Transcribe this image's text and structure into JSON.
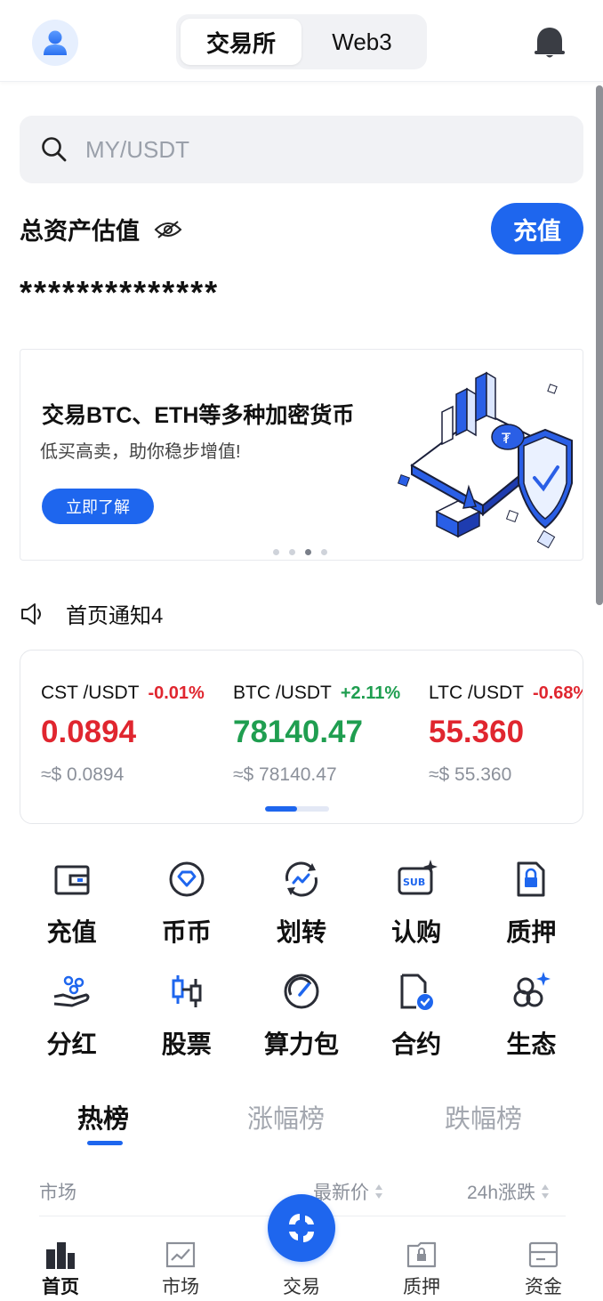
{
  "header": {
    "tabs": [
      {
        "label": "交易所",
        "active": true
      },
      {
        "label": "Web3",
        "active": false
      }
    ],
    "icons": {
      "avatar": "user-icon",
      "bell": "bell-icon"
    }
  },
  "search": {
    "placeholder": "MY/USDT",
    "icon": "search-icon"
  },
  "assets": {
    "label": "总资产估值",
    "value": "**************",
    "recharge_label": "充值",
    "eye_icon": "eye-hidden-icon"
  },
  "banner": {
    "title": "交易BTC、ETH等多种加密货币",
    "subtitle": "低买高卖，助你稳步增值!",
    "button_label": "立即了解",
    "slide_count": 4,
    "active_slide": 3
  },
  "notice": {
    "text": "首页通知4",
    "icon": "speaker-icon"
  },
  "tickers": [
    {
      "pair": "CST /USDT",
      "change": "-0.01%",
      "price": "0.0894",
      "usd": "≈$ 0.0894",
      "trend": "down"
    },
    {
      "pair": "BTC /USDT",
      "change": "+2.11%",
      "price": "78140.47",
      "usd": "≈$ 78140.47",
      "trend": "up"
    },
    {
      "pair": "LTC /USDT",
      "change": "-0.68%",
      "price": "55.360",
      "usd": "≈$ 55.360",
      "trend": "down"
    }
  ],
  "shortcuts": [
    {
      "label": "充值",
      "icon": "wallet-icon"
    },
    {
      "label": "币币",
      "icon": "diamond-coin-icon"
    },
    {
      "label": "划转",
      "icon": "transfer-icon"
    },
    {
      "label": "认购",
      "icon": "subscribe-icon"
    },
    {
      "label": "质押",
      "icon": "lock-file-icon"
    },
    {
      "label": "分红",
      "icon": "dividend-hand-icon"
    },
    {
      "label": "股票",
      "icon": "candlestick-icon"
    },
    {
      "label": "算力包",
      "icon": "gauge-icon"
    },
    {
      "label": "合约",
      "icon": "contract-icon"
    },
    {
      "label": "生态",
      "icon": "ecosystem-icon"
    }
  ],
  "rank": {
    "tabs": [
      {
        "label": "热榜",
        "active": true
      },
      {
        "label": "涨幅榜",
        "active": false
      },
      {
        "label": "跌幅榜",
        "active": false
      }
    ],
    "columns": [
      "市场",
      "最新价",
      "24h涨跌"
    ]
  },
  "bottom_nav": {
    "items": [
      {
        "label": "首页",
        "icon": "home-icon",
        "active": true
      },
      {
        "label": "市场",
        "icon": "market-chart-icon",
        "active": false
      },
      {
        "label": "交易",
        "icon": "trade-icon",
        "active": false
      },
      {
        "label": "质押",
        "icon": "pledge-icon",
        "active": false
      },
      {
        "label": "资金",
        "icon": "funds-icon",
        "active": false
      }
    ]
  },
  "colors": {
    "accent": "#1e66ee",
    "up": "#1f9e50",
    "down": "#e0262f"
  }
}
